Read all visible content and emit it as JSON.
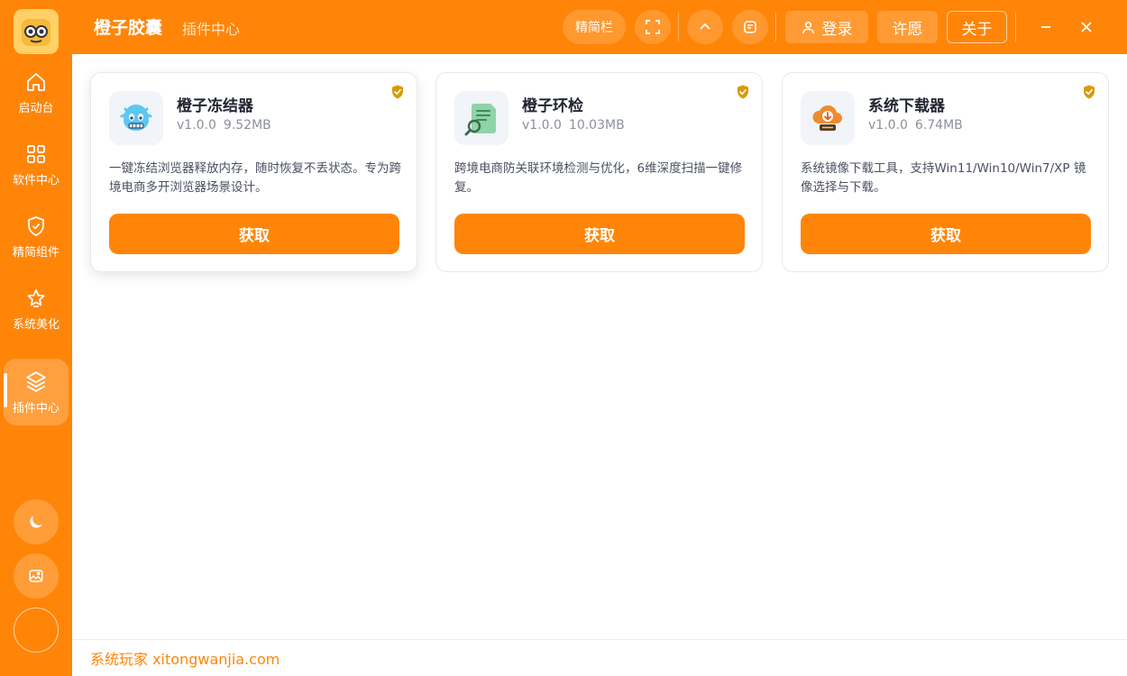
{
  "app": {
    "title": "橙子胶囊",
    "subtitle": "插件中心"
  },
  "toolbar": {
    "simple_bar": "精简栏",
    "login": "登录",
    "wish": "许愿",
    "about": "关于"
  },
  "sidebar": {
    "items": [
      {
        "label": "启动台",
        "icon": "home-icon"
      },
      {
        "label": "软件中心",
        "icon": "grid-icon"
      },
      {
        "label": "精简组件",
        "icon": "shield-check-icon"
      },
      {
        "label": "系统美化",
        "icon": "star-icon"
      },
      {
        "label": "插件中心",
        "icon": "layers-icon",
        "active": true
      }
    ]
  },
  "cards": [
    {
      "title": "橙子冻结器",
      "version": "v1.0.0",
      "size": "9.52MB",
      "desc": "一键冻结浏览器释放内存，随时恢复不丢状态。专为跨境电商多开浏览器场景设计。",
      "button": "获取",
      "icon": "frozen-face-icon"
    },
    {
      "title": "橙子环检",
      "version": "v1.0.0",
      "size": "10.03MB",
      "desc": "跨境电商防关联环境检测与优化，6维深度扫描一键修复。",
      "button": "获取",
      "icon": "document-search-icon"
    },
    {
      "title": "系统下载器",
      "version": "v1.0.0",
      "size": "6.74MB",
      "desc": "系统镜像下载工具，支持Win11/Win10/Win7/XP 镜像选择与下载。",
      "button": "获取",
      "icon": "cloud-download-icon"
    }
  ],
  "footer": {
    "text": "系统玩家 xitongwanjia.com"
  },
  "colors": {
    "accent": "#ff8508",
    "verified": "#d99a00"
  }
}
